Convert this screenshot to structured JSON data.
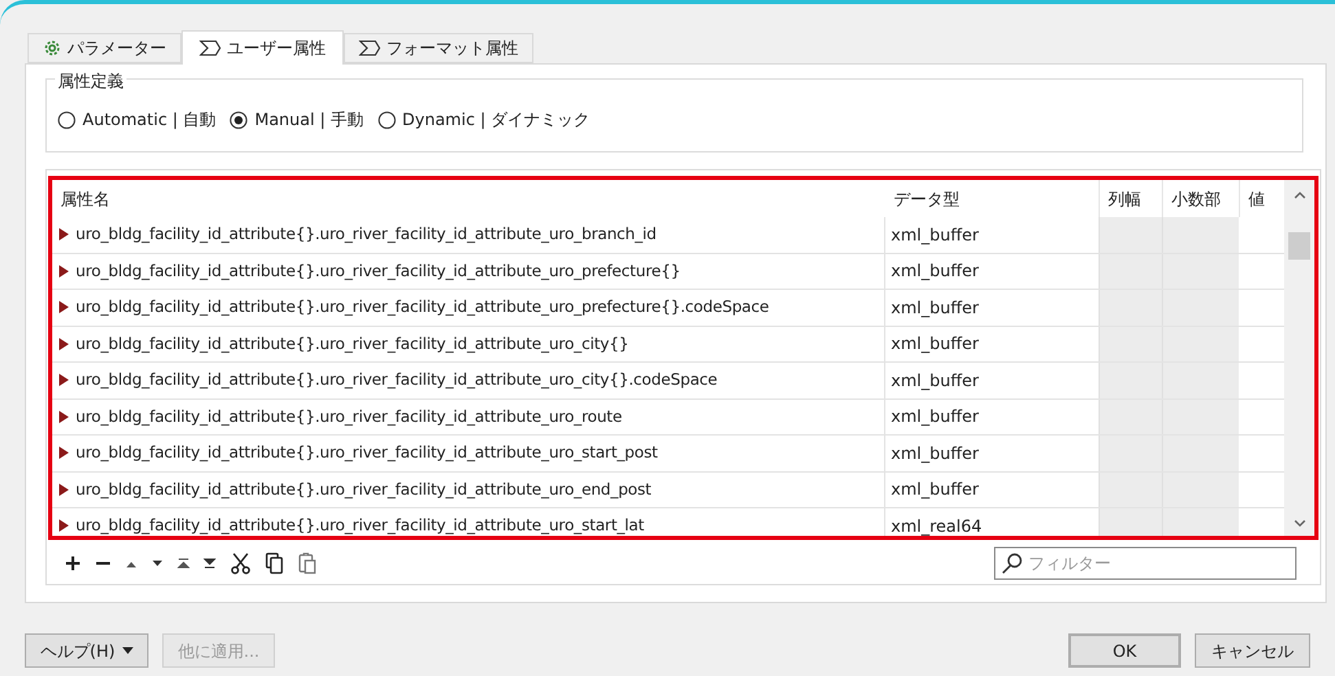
{
  "tabs": [
    {
      "label": "パラメーター",
      "selected": false
    },
    {
      "label": "ユーザー属性",
      "selected": true
    },
    {
      "label": "フォーマット属性",
      "selected": false
    }
  ],
  "group": {
    "title": "属性定義",
    "options": [
      {
        "label": "Automatic | 自動",
        "selected": false
      },
      {
        "label": "Manual | 手動",
        "selected": true
      },
      {
        "label": "Dynamic | ダイナミック",
        "selected": false
      }
    ]
  },
  "table": {
    "columns": [
      "属性名",
      "データ型",
      "列幅",
      "小数部",
      "値"
    ],
    "rows": [
      {
        "name": "uro_bldg_facility_id_attribute{}.uro_river_facility_id_attribute_uro_branch_id",
        "type": "xml_buffer"
      },
      {
        "name": "uro_bldg_facility_id_attribute{}.uro_river_facility_id_attribute_uro_prefecture{}",
        "type": "xml_buffer"
      },
      {
        "name": "uro_bldg_facility_id_attribute{}.uro_river_facility_id_attribute_uro_prefecture{}.codeSpace",
        "type": "xml_buffer"
      },
      {
        "name": "uro_bldg_facility_id_attribute{}.uro_river_facility_id_attribute_uro_city{}",
        "type": "xml_buffer"
      },
      {
        "name": "uro_bldg_facility_id_attribute{}.uro_river_facility_id_attribute_uro_city{}.codeSpace",
        "type": "xml_buffer"
      },
      {
        "name": "uro_bldg_facility_id_attribute{}.uro_river_facility_id_attribute_uro_route",
        "type": "xml_buffer"
      },
      {
        "name": "uro_bldg_facility_id_attribute{}.uro_river_facility_id_attribute_uro_start_post",
        "type": "xml_buffer"
      },
      {
        "name": "uro_bldg_facility_id_attribute{}.uro_river_facility_id_attribute_uro_end_post",
        "type": "xml_buffer"
      },
      {
        "name": "uro_bldg_facility_id_attribute{}.uro_river_facility_id_attribute_uro_start_lat",
        "type": "xml_real64"
      }
    ]
  },
  "filter": {
    "placeholder": "フィルター"
  },
  "buttons": [
    {
      "label": "ヘルプ(H)",
      "kind": "menu",
      "disabled": false
    },
    {
      "label": "他に適用...",
      "kind": "plain",
      "disabled": true
    },
    {
      "label": "OK",
      "kind": "default",
      "disabled": false
    },
    {
      "label": "キャンセル",
      "kind": "plain",
      "disabled": false
    }
  ]
}
